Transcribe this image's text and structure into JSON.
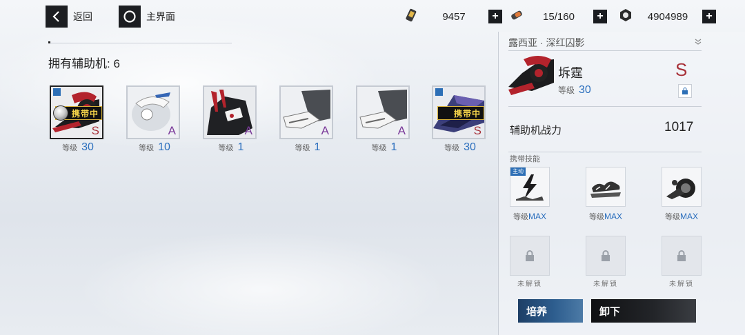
{
  "topbar": {
    "back_label": "返回",
    "home_label": "主界面",
    "resources": [
      {
        "icon": "fuel-icon",
        "value": "9457"
      },
      {
        "icon": "energy-icon",
        "value": "15/160"
      },
      {
        "icon": "gear-coin-icon",
        "value": "4904989"
      }
    ]
  },
  "list": {
    "owned_label": "拥有辅助机: 6",
    "level_label": "等级",
    "carry_label": "携带中",
    "items": [
      {
        "rank": "S",
        "level": "30",
        "carrying": true,
        "locked": true,
        "theme": "red"
      },
      {
        "rank": "A",
        "level": "10",
        "carrying": false,
        "locked": false,
        "theme": "white"
      },
      {
        "rank": "A",
        "level": "1",
        "carrying": false,
        "locked": false,
        "theme": "dark"
      },
      {
        "rank": "A",
        "level": "1",
        "carrying": false,
        "locked": false,
        "theme": "grey"
      },
      {
        "rank": "A",
        "level": "1",
        "carrying": false,
        "locked": false,
        "theme": "grey"
      },
      {
        "rank": "S",
        "level": "30",
        "carrying": true,
        "locked": true,
        "theme": "purple"
      }
    ]
  },
  "detail": {
    "pilot_name": "露西亚 · 深红囚影",
    "machine_name": "坼霆",
    "level_label": "等级",
    "level": "30",
    "rank": "S",
    "power_label": "辅助机战力",
    "power": "1017",
    "skills_title": "携带技能",
    "active_tag": "主动",
    "skill_level_label": "等级",
    "skill_level_max": "MAX",
    "skills": [
      {
        "icon": "lightning-skill-icon"
      },
      {
        "icon": "storm-skill-icon"
      },
      {
        "icon": "vehicle-skill-icon"
      }
    ],
    "locked_label": "未解锁",
    "train_button": "培养",
    "unequip_button": "卸下"
  },
  "colors": {
    "accent_blue": "#2a6ebd",
    "rank_s": "#a8323a",
    "rank_a": "#7b3a9a",
    "carry_gold": "#f5d44a"
  }
}
